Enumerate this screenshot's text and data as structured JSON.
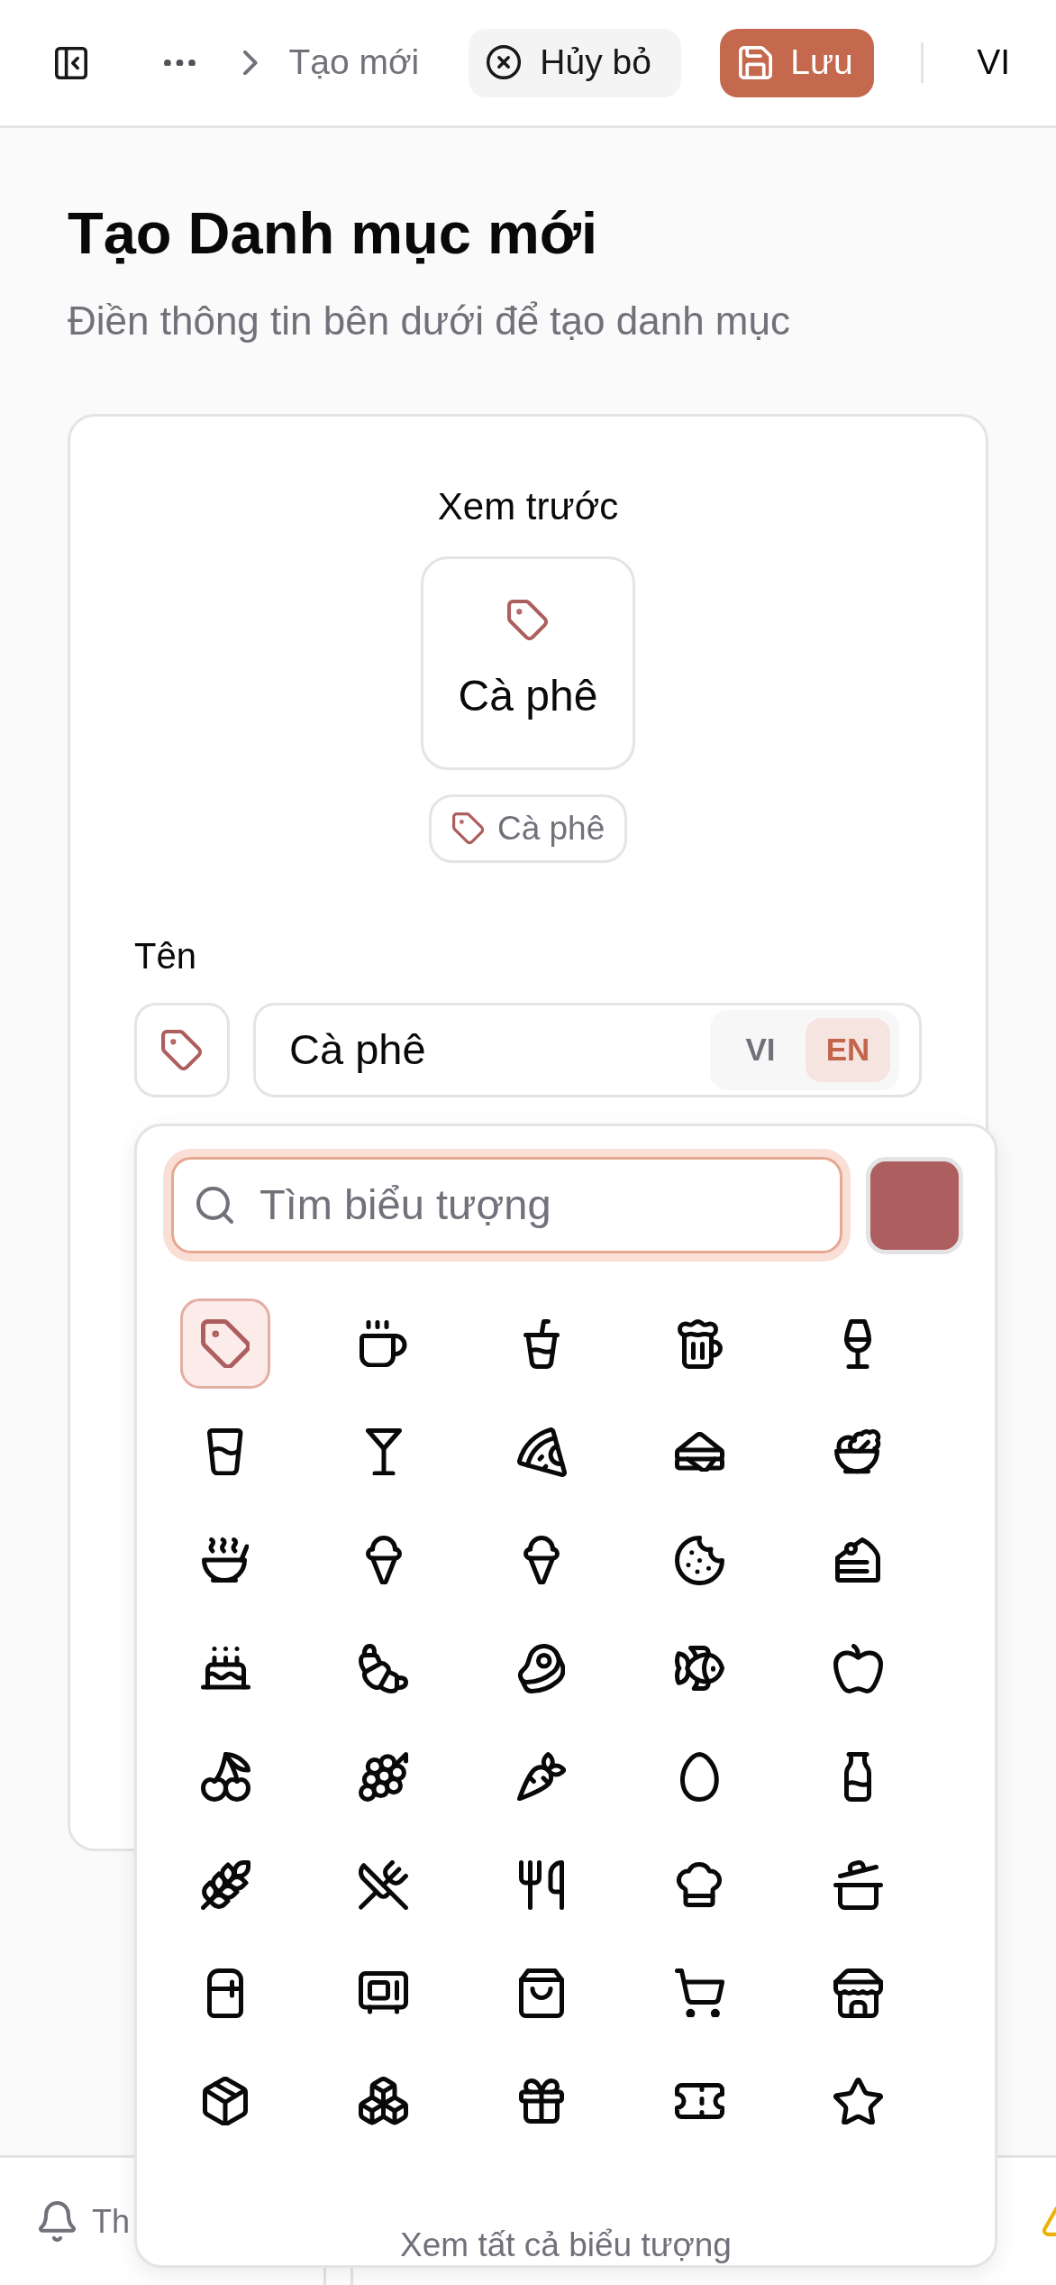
{
  "top_bar": {
    "breadcrumb_current": "Tạo mới",
    "cancel_button": "Hủy bỏ",
    "save_button": "Lưu",
    "language": "VI"
  },
  "page": {
    "title": "Tạo Danh mục mới",
    "subtitle": "Điền thông tin bên dưới để tạo danh mục"
  },
  "form": {
    "preview": {
      "label": "Xem trước",
      "card_name": "Cà phê",
      "chip_name": "Cà phê"
    },
    "name_field": {
      "label": "Tên",
      "value": "Cà phê",
      "languages": [
        {
          "label": "VI",
          "selected": false
        },
        {
          "label": "EN",
          "selected": true
        }
      ]
    }
  },
  "icon_picker": {
    "search": {
      "placeholder": "Tìm biểu tượng"
    },
    "color": "#ad5e5e",
    "icons": [
      {
        "kind": "tag",
        "selected": true
      },
      {
        "kind": "coffee",
        "selected": false
      },
      {
        "kind": "soda",
        "selected": false
      },
      {
        "kind": "beer",
        "selected": false
      },
      {
        "kind": "wine",
        "selected": false
      },
      {
        "kind": "water",
        "selected": false
      },
      {
        "kind": "martini",
        "selected": false
      },
      {
        "kind": "pizza",
        "selected": false
      },
      {
        "kind": "sandwich",
        "selected": false
      },
      {
        "kind": "salad",
        "selected": false
      },
      {
        "kind": "soup",
        "selected": false
      },
      {
        "kind": "icecream",
        "selected": false
      },
      {
        "kind": "icecream",
        "selected": false
      },
      {
        "kind": "cookie",
        "selected": false
      },
      {
        "kind": "slice",
        "selected": false
      },
      {
        "kind": "cake",
        "selected": false
      },
      {
        "kind": "croissant",
        "selected": false
      },
      {
        "kind": "steak",
        "selected": false
      },
      {
        "kind": "fish",
        "selected": false
      },
      {
        "kind": "apple",
        "selected": false
      },
      {
        "kind": "cherry",
        "selected": false
      },
      {
        "kind": "grape",
        "selected": false
      },
      {
        "kind": "carrot",
        "selected": false
      },
      {
        "kind": "egg",
        "selected": false
      },
      {
        "kind": "milk",
        "selected": false
      },
      {
        "kind": "wheat",
        "selected": false
      },
      {
        "kind": "crossed",
        "selected": false
      },
      {
        "kind": "utensils",
        "selected": false
      },
      {
        "kind": "chef",
        "selected": false
      },
      {
        "kind": "pot",
        "selected": false
      },
      {
        "kind": "fridge",
        "selected": false
      },
      {
        "kind": "microwave",
        "selected": false
      },
      {
        "kind": "bag",
        "selected": false
      },
      {
        "kind": "cart",
        "selected": false
      },
      {
        "kind": "store",
        "selected": false
      },
      {
        "kind": "package",
        "selected": false
      },
      {
        "kind": "boxes",
        "selected": false
      },
      {
        "kind": "gift",
        "selected": false
      },
      {
        "kind": "ticket",
        "selected": false
      },
      {
        "kind": "star",
        "selected": false
      }
    ],
    "view_all": "Xem tất cả biểu tượng"
  },
  "bottom_panel": {
    "label": "Th"
  }
}
